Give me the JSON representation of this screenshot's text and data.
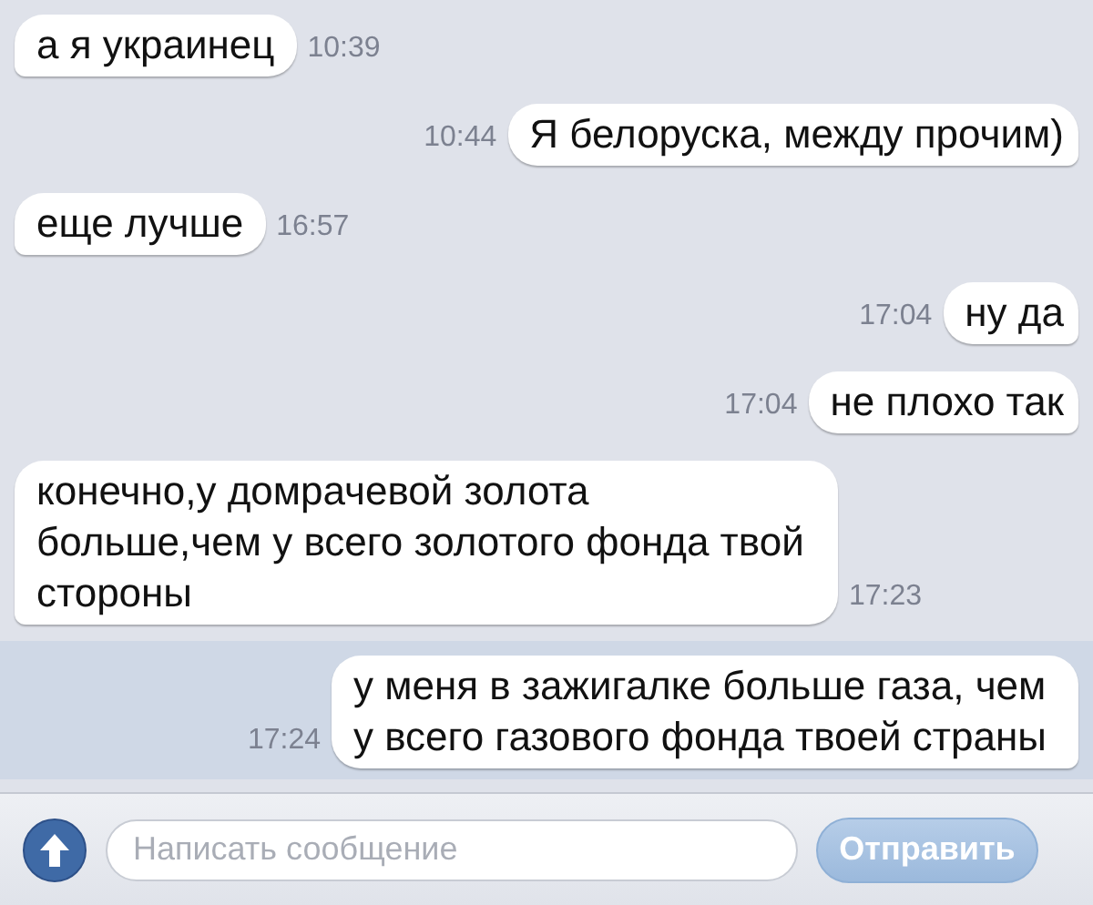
{
  "messages": [
    {
      "kind": "incoming",
      "text": "а я украинец",
      "time": "10:39",
      "highlighted": false
    },
    {
      "kind": "outgoing",
      "text": "Я белоруска, между прочим)",
      "time": "10:44",
      "highlighted": false
    },
    {
      "kind": "incoming",
      "text": "еще лучше",
      "time": "16:57",
      "highlighted": false
    },
    {
      "kind": "outgoing",
      "text": "ну да",
      "time": "17:04",
      "highlighted": false
    },
    {
      "kind": "outgoing",
      "text": "не плохо так",
      "time": "17:04",
      "highlighted": false
    },
    {
      "kind": "incoming",
      "text": "конечно,у домрачевой золота больше,чем у всего золотого фонда твой стороны",
      "time": "17:23",
      "highlighted": false
    },
    {
      "kind": "outgoing",
      "text": "у меня в зажигалке больше газа, чем у всего газового фонда твоей страны",
      "time": "17:24",
      "highlighted": true
    }
  ],
  "composer": {
    "placeholder": "Написать сообщение",
    "send_label": "Отправить"
  }
}
